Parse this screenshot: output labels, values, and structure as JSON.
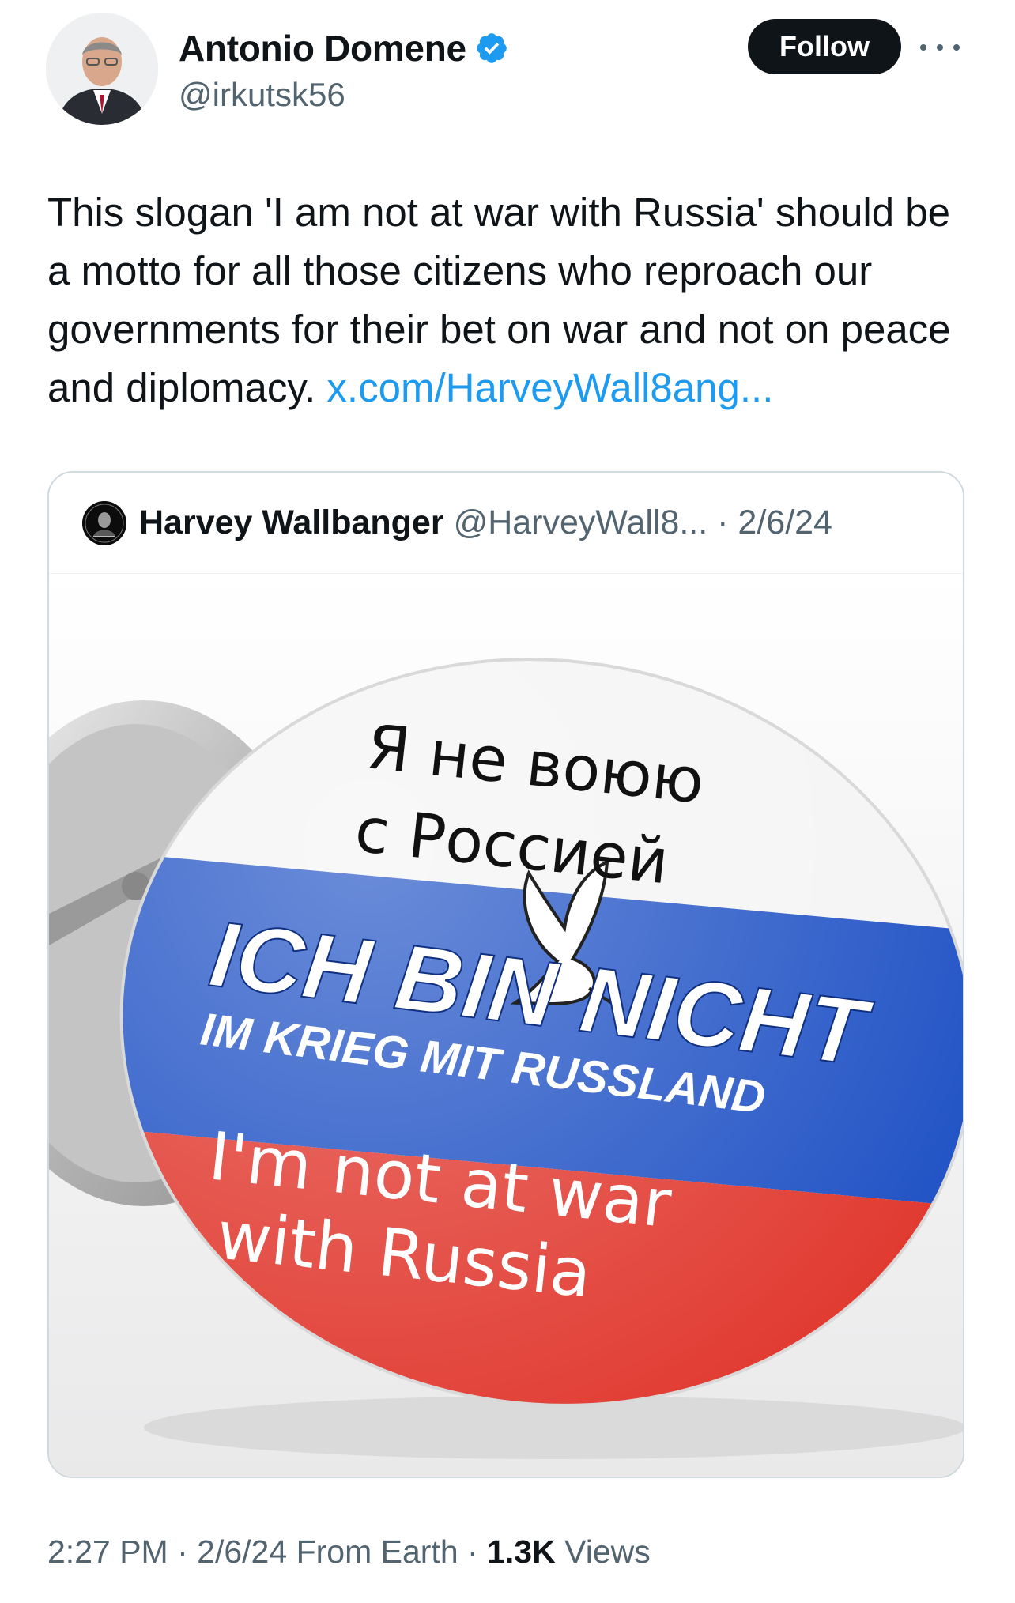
{
  "author": {
    "display_name": "Antonio Domene",
    "handle": "@irkutsk56",
    "verified": true,
    "avatar_icon": "profile-photo"
  },
  "actions": {
    "follow_label": "Follow",
    "more_icon": "more-horizontal-icon"
  },
  "tweet": {
    "text": "This slogan 'I am not at war with Russia' should be a motto for all those citizens who reproach our governments for their bet on war and not on peace and diplomacy.",
    "link": "x.com/HarveyWall8ang..."
  },
  "quoted": {
    "display_name": "Harvey Wallbanger",
    "handle": "@HarveyWall8...",
    "separator": "·",
    "date": "2/6/24",
    "image": {
      "line_ru_1": "Я не воюю",
      "line_ru_2": "с Россией",
      "line_de_1": "ICH BIN NICHT",
      "line_de_2": "IM KRIEG MIT RUSSLAND",
      "line_en_1": "I'm not at war",
      "line_en_2": "with Russia"
    }
  },
  "meta": {
    "time": "2:27 PM",
    "sep1": "·",
    "date": "2/6/24",
    "source": "From Earth",
    "sep2": "·",
    "views_count": "1.3K",
    "views_label": "Views"
  },
  "colors": {
    "link": "#1d9bf0",
    "verified": "#1d9bf0",
    "flag_white": "#f4f4f4",
    "flag_blue": "#1c4fc4",
    "flag_red": "#e0352b"
  }
}
